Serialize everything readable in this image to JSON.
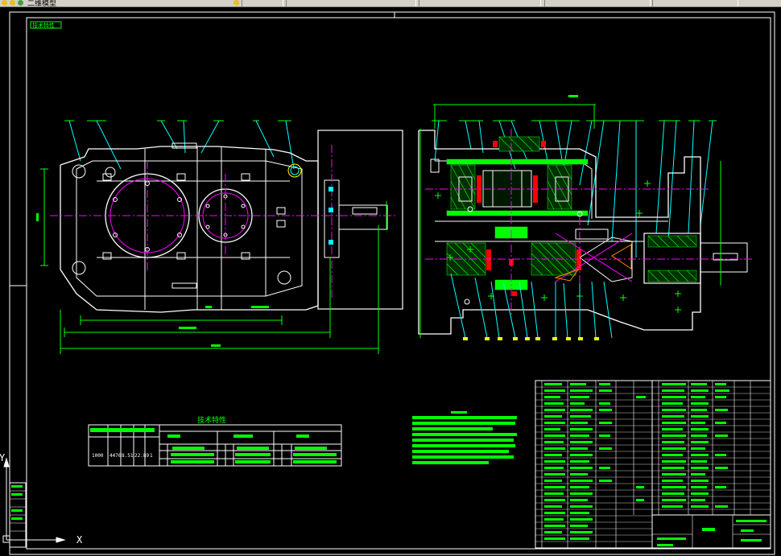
{
  "window": {
    "toolbar_label": "二维模型"
  },
  "ucs": {
    "y_label": "Y",
    "x_label": "X"
  },
  "colors": {
    "background": "#000000",
    "frame": "#ffffff",
    "outline": "#ffffff",
    "dimension": "#00ff00",
    "center_line": "#ff00ff",
    "hatch": "#00ff00",
    "leader": "#00ffff",
    "bolt": "#ffff00",
    "parts": "#ff0000",
    "table": "#ffffff"
  },
  "drawing": {
    "title_tag": "技术特性",
    "tech_table": {
      "title": "技术特性",
      "values": [
        "1000",
        "4476",
        "8.51",
        "22.89",
        "1"
      ]
    }
  }
}
